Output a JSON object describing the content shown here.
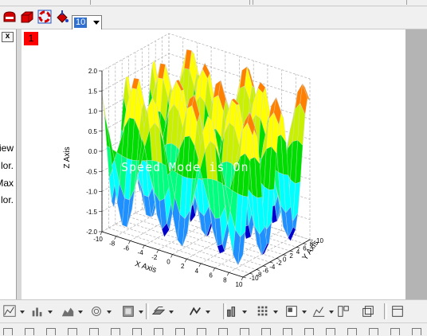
{
  "toolbar_top": {
    "buttons": [
      {
        "name": "layer-red-icon"
      },
      {
        "name": "box-red-icon"
      },
      {
        "name": "lifebuoy-icon"
      },
      {
        "name": "paint-bucket-icon"
      }
    ],
    "zoom_combo": {
      "value": "10"
    }
  },
  "left_panel": {
    "close_label": "x",
    "rows": [
      "iew",
      "lor.",
      "Max",
      "lor."
    ]
  },
  "graph_window": {
    "index": "1",
    "overlay_text": "Speed Mode is On"
  },
  "chart_data": {
    "type": "surface-3d",
    "xlabel": "X Axis",
    "ylabel": "Y Axis",
    "zlabel": "Z Axis",
    "xlim": [
      -10,
      10
    ],
    "ylim": [
      -10,
      10
    ],
    "zlim": [
      -2.0,
      2.0
    ],
    "x_ticks": [
      "-10",
      "-8",
      "-6",
      "-4",
      "-2",
      "0",
      "2",
      "4",
      "6",
      "8",
      "10"
    ],
    "y_ticks": [
      "-10",
      "-8",
      "-6",
      "-4",
      "-2",
      "0",
      "2",
      "4",
      "6",
      "8",
      "10"
    ],
    "z_ticks": [
      "-2.0",
      "-1.5",
      "-1.0",
      "-0.5",
      "0.0",
      "0.5",
      "1.0",
      "1.5",
      "2.0"
    ],
    "grid": true,
    "colormap": [
      "#0000cd",
      "#1e90ff",
      "#00ffff",
      "#00ff7f",
      "#00dd00",
      "#c8f000",
      "#ffff00",
      "#ff8000"
    ]
  },
  "toolbar_bottom": {
    "icons": [
      "scatter-plot-icon",
      "bar-chart-icon",
      "area-chart-icon",
      "polar-icon",
      "contour-icon",
      "surface-icon",
      "waterfall-icon",
      "3d-bar-icon",
      "matrix-icon",
      "image-plot-icon",
      "stats-icon",
      "layout-icon",
      "layer-icon",
      "window-icon"
    ]
  }
}
